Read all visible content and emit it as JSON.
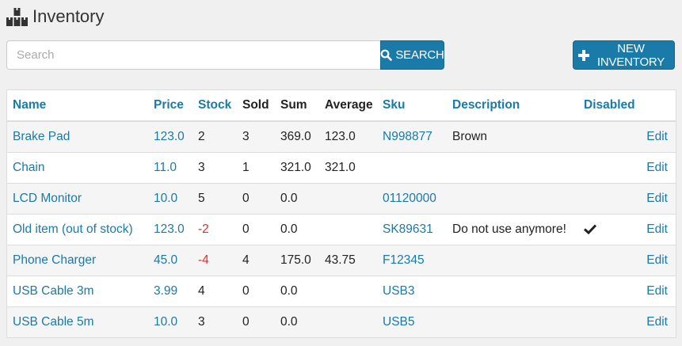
{
  "header": {
    "title": "Inventory",
    "icon": "boxes-icon"
  },
  "search": {
    "placeholder": "Search",
    "value": "",
    "button_label": "Search",
    "button_icon": "search-icon"
  },
  "new_inventory": {
    "label": "New Inventory",
    "icon": "plus-icon"
  },
  "table": {
    "columns": [
      "Name",
      "Price",
      "Stock",
      "Sold",
      "Sum",
      "Average",
      "Sku",
      "Description",
      "Disabled"
    ],
    "rows": [
      {
        "name": "Brake Pad",
        "price": "123.0",
        "stock": "2",
        "stock_negative": false,
        "sold": "3",
        "sum": "369.0",
        "average": "123.0",
        "sku": "N998877",
        "description": "Brown",
        "disabled": false,
        "action": "Edit"
      },
      {
        "name": "Chain",
        "price": "11.0",
        "stock": "3",
        "stock_negative": false,
        "sold": "1",
        "sum": "321.0",
        "average": "321.0",
        "sku": "",
        "description": "",
        "disabled": false,
        "action": "Edit"
      },
      {
        "name": "LCD Monitor",
        "price": "10.0",
        "stock": "5",
        "stock_negative": false,
        "sold": "0",
        "sum": "0.0",
        "average": "",
        "sku": "01120000",
        "description": "",
        "disabled": false,
        "action": "Edit"
      },
      {
        "name": "Old item (out of stock)",
        "price": "123.0",
        "stock": "-2",
        "stock_negative": true,
        "sold": "0",
        "sum": "0.0",
        "average": "",
        "sku": "SK89631",
        "description": "Do not use anymore!",
        "disabled": true,
        "action": "Edit"
      },
      {
        "name": "Phone Charger",
        "price": "45.0",
        "stock": "-4",
        "stock_negative": true,
        "sold": "4",
        "sum": "175.0",
        "average": "43.75",
        "sku": "F12345",
        "description": "",
        "disabled": false,
        "action": "Edit"
      },
      {
        "name": "USB Cable 3m",
        "price": "3.99",
        "stock": "4",
        "stock_negative": false,
        "sold": "0",
        "sum": "0.0",
        "average": "",
        "sku": "USB3",
        "description": "",
        "disabled": false,
        "action": "Edit"
      },
      {
        "name": "USB Cable 5m",
        "price": "10.0",
        "stock": "3",
        "stock_negative": false,
        "sold": "0",
        "sum": "0.0",
        "average": "",
        "sku": "USB5",
        "description": "",
        "disabled": false,
        "action": "Edit"
      }
    ]
  },
  "colors": {
    "accent": "#1a7aa8",
    "negative": "#d9302c"
  }
}
